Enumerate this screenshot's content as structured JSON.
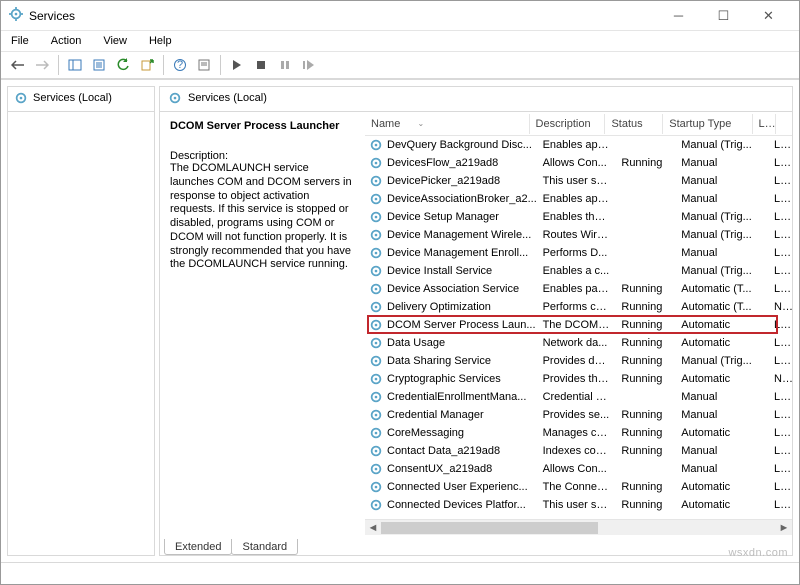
{
  "window": {
    "title": "Services"
  },
  "menu": {
    "file": "File",
    "action": "Action",
    "view": "View",
    "help": "Help"
  },
  "tree": {
    "root": "Services (Local)"
  },
  "main": {
    "heading": "Services (Local)",
    "selected_title": "DCOM Server Process Launcher",
    "description_label": "Description:",
    "description_text": "The DCOMLAUNCH service launches COM and DCOM servers in response to object activation requests. If this service is stopped or disabled, programs using COM or DCOM will not function properly. It is strongly recommended that you have the DCOMLAUNCH service running."
  },
  "columns": {
    "name": "Name",
    "desc": "Description",
    "status": "Status",
    "start": "Startup Type",
    "logon": "Lo"
  },
  "rows": [
    {
      "name": "DevQuery Background Disc...",
      "desc": "Enables app...",
      "status": "",
      "start": "Manual (Trig...",
      "logon": "Lo"
    },
    {
      "name": "DevicesFlow_a219ad8",
      "desc": "Allows Con...",
      "status": "Running",
      "start": "Manual",
      "logon": "Lo"
    },
    {
      "name": "DevicePicker_a219ad8",
      "desc": "This user ser...",
      "status": "",
      "start": "Manual",
      "logon": "Lo"
    },
    {
      "name": "DeviceAssociationBroker_a2...",
      "desc": "Enables app...",
      "status": "",
      "start": "Manual",
      "logon": "Lo"
    },
    {
      "name": "Device Setup Manager",
      "desc": "Enables the ...",
      "status": "",
      "start": "Manual (Trig...",
      "logon": "Lo"
    },
    {
      "name": "Device Management Wirele...",
      "desc": "Routes Wire...",
      "status": "",
      "start": "Manual (Trig...",
      "logon": "Lo"
    },
    {
      "name": "Device Management Enroll...",
      "desc": "Performs D...",
      "status": "",
      "start": "Manual",
      "logon": "Lo"
    },
    {
      "name": "Device Install Service",
      "desc": "Enables a c...",
      "status": "",
      "start": "Manual (Trig...",
      "logon": "Lo"
    },
    {
      "name": "Device Association Service",
      "desc": "Enables pair...",
      "status": "Running",
      "start": "Automatic (T...",
      "logon": "Lo"
    },
    {
      "name": "Delivery Optimization",
      "desc": "Performs co...",
      "status": "Running",
      "start": "Automatic (T...",
      "logon": "Ne"
    },
    {
      "name": "DCOM Server Process Laun...",
      "desc": "The DCOML...",
      "status": "Running",
      "start": "Automatic",
      "logon": "Lo"
    },
    {
      "name": "Data Usage",
      "desc": "Network da...",
      "status": "Running",
      "start": "Automatic",
      "logon": "Lo"
    },
    {
      "name": "Data Sharing Service",
      "desc": "Provides da...",
      "status": "Running",
      "start": "Manual (Trig...",
      "logon": "Lo"
    },
    {
      "name": "Cryptographic Services",
      "desc": "Provides thr...",
      "status": "Running",
      "start": "Automatic",
      "logon": "Ne"
    },
    {
      "name": "CredentialEnrollmentMana...",
      "desc": "Credential E...",
      "status": "",
      "start": "Manual",
      "logon": "Lo"
    },
    {
      "name": "Credential Manager",
      "desc": "Provides se...",
      "status": "Running",
      "start": "Manual",
      "logon": "Lo"
    },
    {
      "name": "CoreMessaging",
      "desc": "Manages co...",
      "status": "Running",
      "start": "Automatic",
      "logon": "Lo"
    },
    {
      "name": "Contact Data_a219ad8",
      "desc": "Indexes con...",
      "status": "Running",
      "start": "Manual",
      "logon": "Lo"
    },
    {
      "name": "ConsentUX_a219ad8",
      "desc": "Allows Con...",
      "status": "",
      "start": "Manual",
      "logon": "Lo"
    },
    {
      "name": "Connected User Experienc...",
      "desc": "The Connec...",
      "status": "Running",
      "start": "Automatic",
      "logon": "Lo"
    },
    {
      "name": "Connected Devices Platfor...",
      "desc": "This user ser...",
      "status": "Running",
      "start": "Automatic",
      "logon": "Lo"
    }
  ],
  "tabs": {
    "extended": "Extended",
    "standard": "Standard"
  },
  "highlight_index": 10,
  "watermark": "wsxdn.com"
}
